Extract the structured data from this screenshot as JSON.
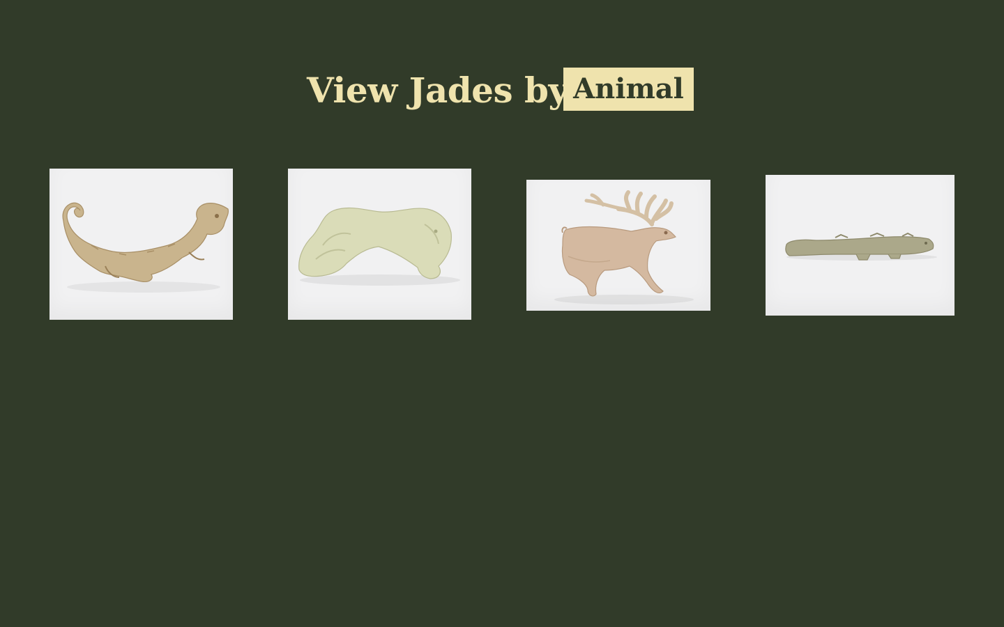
{
  "header": {
    "title": "View Jades by",
    "filter_label": "Animal"
  },
  "gallery": {
    "items": [
      {
        "depicts": "dragon-pendant",
        "color": "#c9b48d"
      },
      {
        "depicts": "crouching-tiger",
        "color": "#dadcb8"
      },
      {
        "depicts": "deer-plaque",
        "color": "#d4b9a0"
      },
      {
        "depicts": "fish-ornament",
        "color": "#aba88a"
      }
    ]
  },
  "colors": {
    "background": "#313b29",
    "accent": "#efe3ad",
    "card": "#f1f1f2"
  }
}
